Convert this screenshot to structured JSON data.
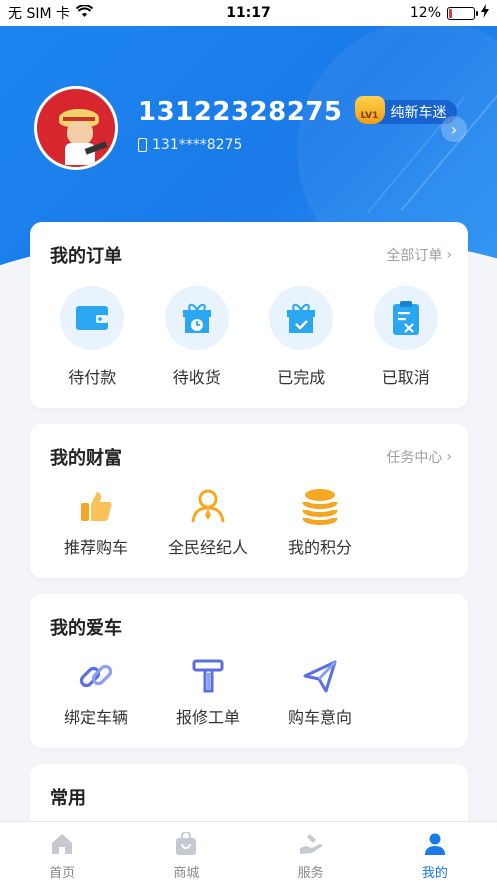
{
  "status_bar": {
    "carrier": "无 SIM 卡",
    "time": "11:17",
    "battery": "12%",
    "battery_level": 0.12
  },
  "profile": {
    "phone": "13122328275",
    "level_badge": "LV1",
    "level_name": "纯新车迷",
    "masked_phone": "131****8275"
  },
  "orders": {
    "title": "我的订单",
    "link": "全部订单",
    "items": [
      {
        "label": "待付款",
        "icon": "wallet-icon"
      },
      {
        "label": "待收货",
        "icon": "gift-clock-icon"
      },
      {
        "label": "已完成",
        "icon": "gift-check-icon"
      },
      {
        "label": "已取消",
        "icon": "clipboard-x-icon"
      }
    ]
  },
  "wealth": {
    "title": "我的财富",
    "link": "任务中心",
    "items": [
      {
        "label": "推荐购车",
        "icon": "thumbs-up-icon"
      },
      {
        "label": "全民经纪人",
        "icon": "agent-icon"
      },
      {
        "label": "我的积分",
        "icon": "coins-icon"
      }
    ]
  },
  "car": {
    "title": "我的爱车",
    "items": [
      {
        "label": "绑定车辆",
        "icon": "link-icon"
      },
      {
        "label": "报修工单",
        "icon": "hammer-icon"
      },
      {
        "label": "购车意向",
        "icon": "paper-plane-icon"
      }
    ]
  },
  "common": {
    "title": "常用"
  },
  "tabbar": [
    {
      "label": "首页",
      "icon": "home-icon"
    },
    {
      "label": "商城",
      "icon": "shop-bag-icon"
    },
    {
      "label": "服务",
      "icon": "service-icon"
    },
    {
      "label": "我的",
      "icon": "user-icon",
      "active": true
    }
  ],
  "colors": {
    "primary": "#1a7ae8",
    "orange": "#f5a623",
    "icon_blue": "#2aa7f0"
  }
}
